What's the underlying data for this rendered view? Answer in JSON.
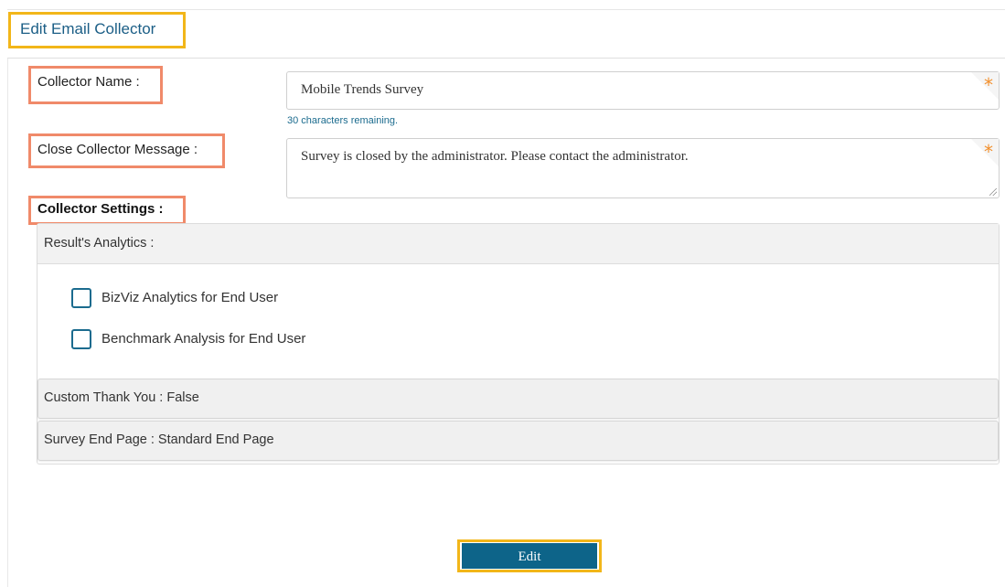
{
  "page": {
    "title": "Edit Email Collector"
  },
  "form": {
    "collector_name_label": "Collector Name :",
    "collector_name_value": "Mobile Trends Survey",
    "collector_name_hint": "30 characters remaining.",
    "close_message_label": "Close Collector Message :",
    "close_message_value": "Survey is closed by the administrator. Please contact the administrator.",
    "required_marker": "*"
  },
  "settings": {
    "heading": "Collector Settings :",
    "analytics_header": "Result's Analytics :",
    "options": [
      {
        "label": "BizViz Analytics for End User",
        "checked": false
      },
      {
        "label": "Benchmark Analysis for End User",
        "checked": false
      }
    ],
    "custom_thank_you": "Custom Thank You : False",
    "survey_end_page": "Survey End Page : Standard End Page"
  },
  "actions": {
    "edit_label": "Edit"
  },
  "colors": {
    "accent": "#0d6489",
    "highlight_yellow": "#f2b619",
    "highlight_orange": "#f08a6a",
    "required": "#f28f2c"
  }
}
